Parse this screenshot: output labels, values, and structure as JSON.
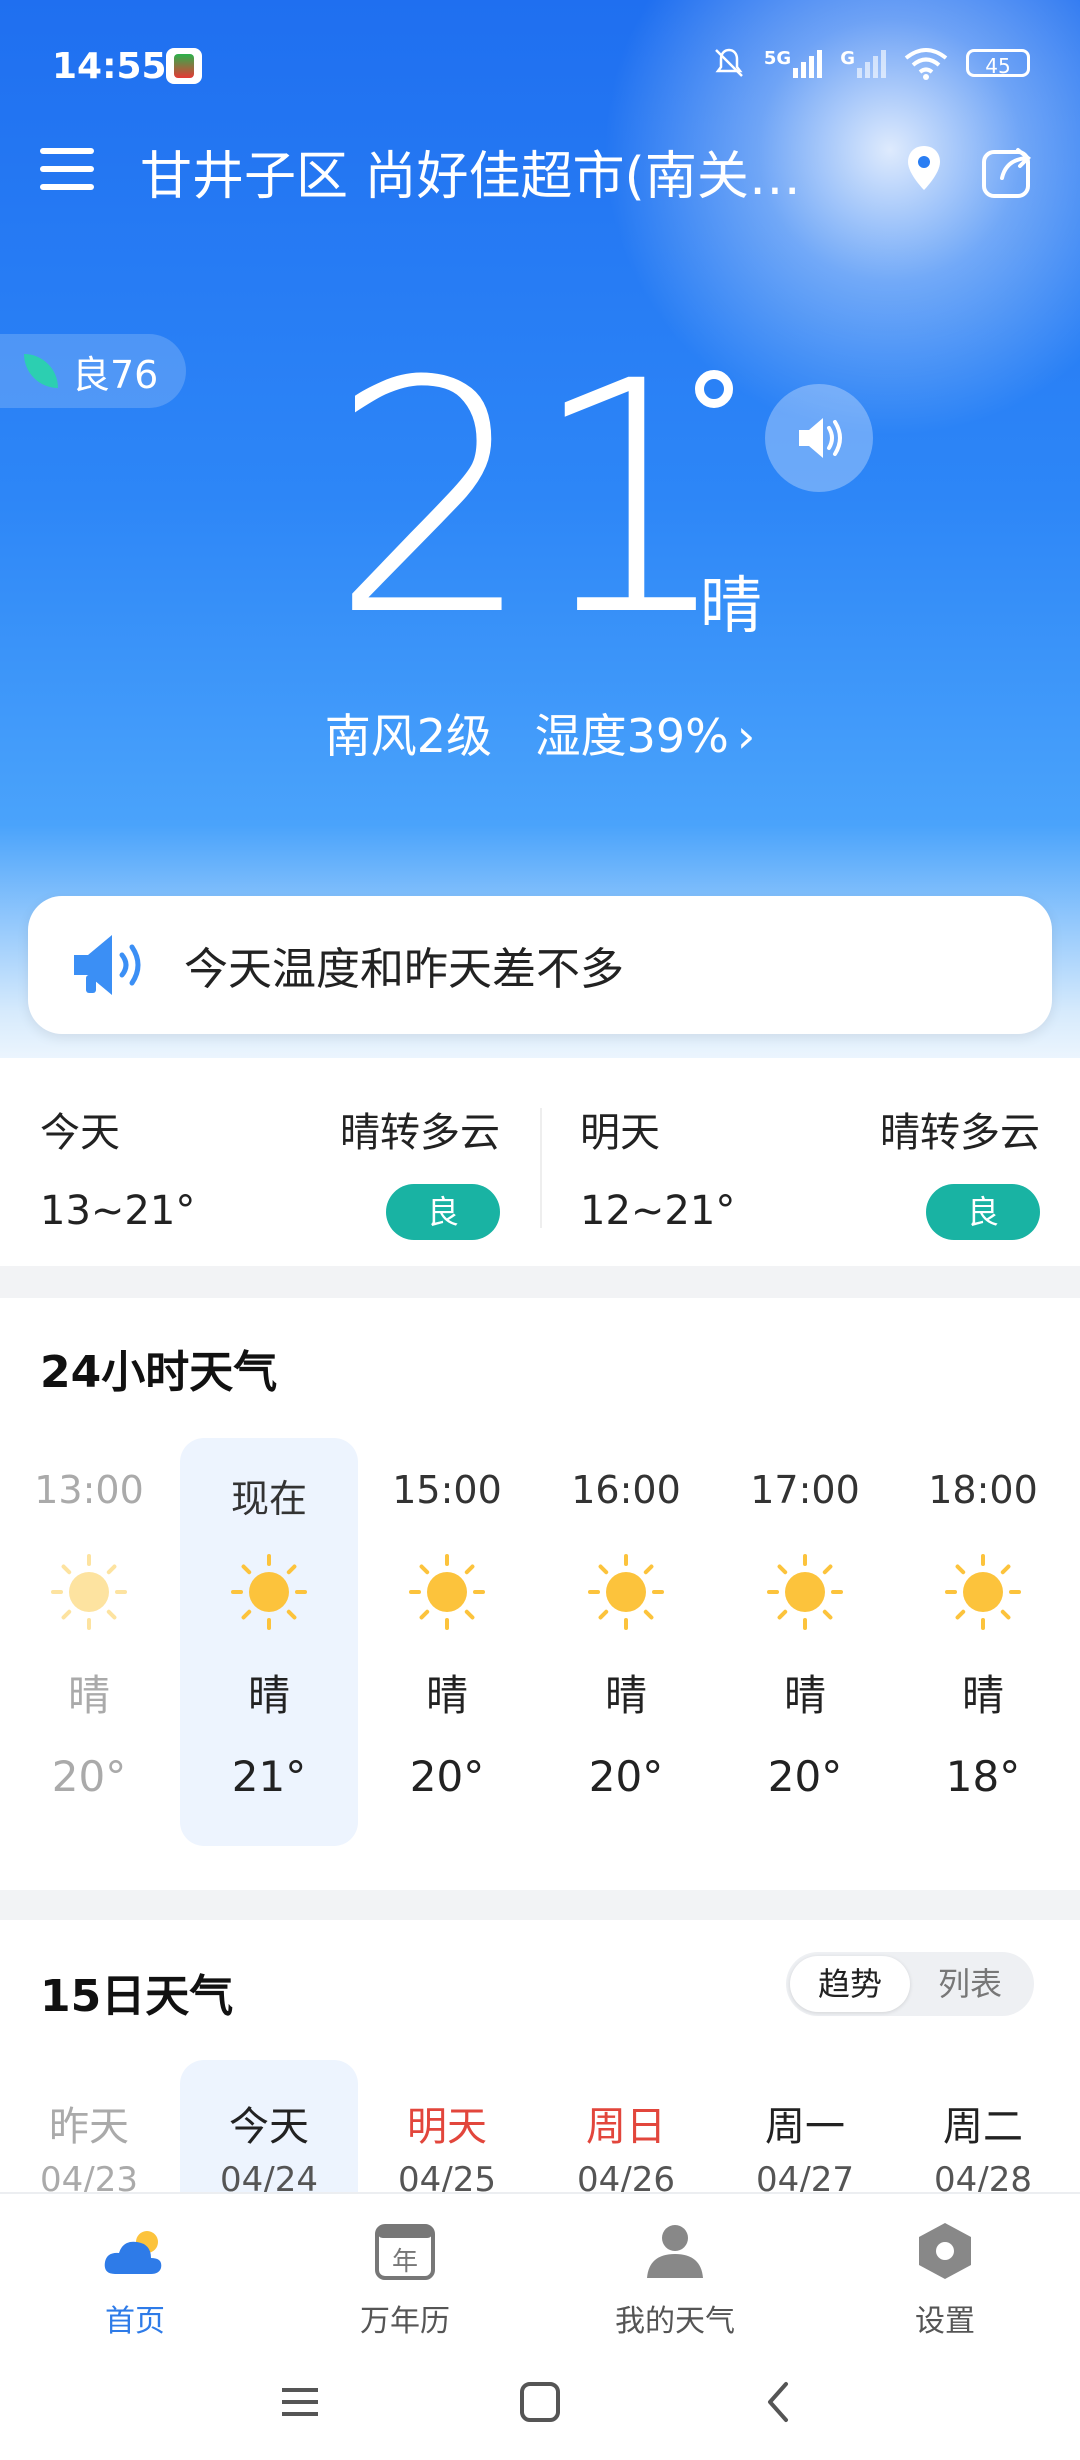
{
  "status_bar": {
    "time": "14:55",
    "network_1": "5G",
    "network_2": "G",
    "battery": "45"
  },
  "header": {
    "location": "甘井子区 尚好佳超市(南关…"
  },
  "current": {
    "aqi_label": "良76",
    "temperature": "21",
    "condition": "晴",
    "wind": "南风2级",
    "humidity": "湿度39%",
    "chevron": "›"
  },
  "tip": {
    "text": "今天温度和昨天差不多"
  },
  "summary": {
    "today": {
      "label": "今天",
      "condition": "晴转多云",
      "temp": "13~21°",
      "aqi": "良"
    },
    "tomorrow": {
      "label": "明天",
      "condition": "晴转多云",
      "temp": "12~21°",
      "aqi": "良"
    }
  },
  "hourly": {
    "title": "24小时天气",
    "items": [
      {
        "time": "13:00",
        "condition": "晴",
        "temp": "20°"
      },
      {
        "time": "现在",
        "condition": "晴",
        "temp": "21°"
      },
      {
        "time": "15:00",
        "condition": "晴",
        "temp": "20°"
      },
      {
        "time": "16:00",
        "condition": "晴",
        "temp": "20°"
      },
      {
        "time": "17:00",
        "condition": "晴",
        "temp": "20°"
      },
      {
        "time": "18:00",
        "condition": "晴",
        "temp": "18°"
      }
    ]
  },
  "daily": {
    "title": "15日天气",
    "toggle_trend": "趋势",
    "toggle_list": "列表",
    "items": [
      {
        "name": "昨天",
        "date": "04/23"
      },
      {
        "name": "今天",
        "date": "04/24"
      },
      {
        "name": "明天",
        "date": "04/25"
      },
      {
        "name": "周日",
        "date": "04/26"
      },
      {
        "name": "周一",
        "date": "04/27"
      },
      {
        "name": "周二",
        "date": "04/28"
      }
    ]
  },
  "bottom_nav": {
    "home": "首页",
    "calendar": "万年历",
    "calendar_glyph": "年",
    "my_weather": "我的天气",
    "settings": "设置"
  },
  "colors": {
    "primary": "#2e7be8",
    "aqi_green": "#19b3a3",
    "weekend_red": "#e2463c",
    "sun": "#fcc33c"
  }
}
